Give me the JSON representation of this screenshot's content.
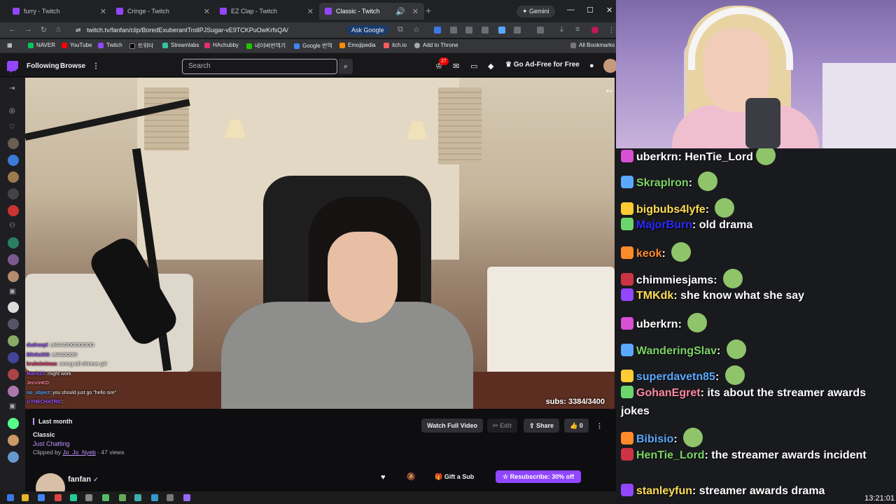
{
  "browser": {
    "tabs": [
      {
        "title": "furry - Twitch",
        "active": false
      },
      {
        "title": "Cringe - Twitch",
        "active": false
      },
      {
        "title": "EZ Clap - Twitch",
        "active": false
      },
      {
        "title": "Classic - Twitch",
        "active": true
      }
    ],
    "gemini_label": "Gemini",
    "url": "twitch.tv/fanfan/clip/BoredExuberantTrollPJSugar-vE9TCKPuOwKrfsQA/",
    "ask_google": "Ask Google",
    "bookmarks": [
      "NAVER",
      "YouTube",
      "Twitch",
      "트위터",
      "Streamlabs",
      "HAchubby",
      "네이버번역기",
      "Google 번역",
      "Emojipedia",
      "itch.io",
      "Add to Throne"
    ],
    "all_bookmarks": "All Bookmarks"
  },
  "twitch": {
    "nav": {
      "following": "Following",
      "browse": "Browse",
      "search_placeholder": "Search",
      "notif_count": "27",
      "ad_free": "Go Ad-Free for Free"
    },
    "overlay_chat": [
      {
        "name": "dudruspl",
        "text": ": LMAAOOOOOOOO"
      },
      {
        "name": "Blinkz303",
        "text": ": LMAOOOO"
      },
      {
        "name": "krulmimimas",
        "text": ": wrong tall chinese girl"
      },
      {
        "name": "Mari023",
        "text": ": might work"
      },
      {
        "name": "JecvinKD",
        "text": ":"
      },
      {
        "name": "no_object",
        "text": ": you should just go \"hello sire\""
      },
      {
        "name": "GYNECHATRIC",
        "text": ":"
      }
    ],
    "subs": "subs: 3384/3400",
    "clip": {
      "when": "Last month",
      "title": "Classic",
      "category": "Just Chatting",
      "clipped_by_label": "Clipped by",
      "clipper": "Jo_Jo_Nyeb",
      "views": "· 47 views",
      "watch_full": "Watch Full Video",
      "edit": "Edit",
      "share": "Share",
      "likes": "0"
    },
    "channel": {
      "name": "fanfan",
      "gift_sub": "Gift a Sub",
      "resub": "Resubscribe: 30% off"
    }
  },
  "chat": [
    {
      "user": "uberkrn",
      "color": "#ffffff",
      "text": "HenTie_Lord",
      "emote": true
    },
    {
      "user": "Skraplron",
      "color": "#7cd466",
      "text": "",
      "emote": true
    },
    {
      "user": "bigbubs4lyfe",
      "color": "#ffdd55",
      "text": "",
      "emote": true
    },
    {
      "user": "MajorBurn",
      "color": "#2a2aff",
      "text": "old drama",
      "emote": false
    },
    {
      "user": "keok",
      "color": "#ff8a2a",
      "text": "",
      "emote": true
    },
    {
      "user": "chimmiesjams",
      "color": "#ffffff",
      "text": "",
      "emote": true
    },
    {
      "user": "TMKdk",
      "color": "#ffdd55",
      "text": "she know what she say",
      "emote": false
    },
    {
      "user": "uberkrn",
      "color": "#ffffff",
      "text": "",
      "emote": true
    },
    {
      "user": "WanderingSlav",
      "color": "#7cd466",
      "text": "",
      "emote": true
    },
    {
      "user": "superdavetn85",
      "color": "#5aa9ff",
      "text": "",
      "emote": true
    },
    {
      "user": "GohanEgret",
      "color": "#ff8aa0",
      "text": "its about the streamer awards jokes",
      "emote": false
    },
    {
      "user": "Bibisio",
      "color": "#5aa9ff",
      "text": "",
      "emote": true
    },
    {
      "user": "HenTie_Lord",
      "color": "#7cd466",
      "text": "the streamer awards incident",
      "emote": false
    },
    {
      "user": "stanleyfun",
      "color": "#ffdd55",
      "text": "streamer awards drama",
      "emote": false
    }
  ],
  "clock": "13:21:01"
}
